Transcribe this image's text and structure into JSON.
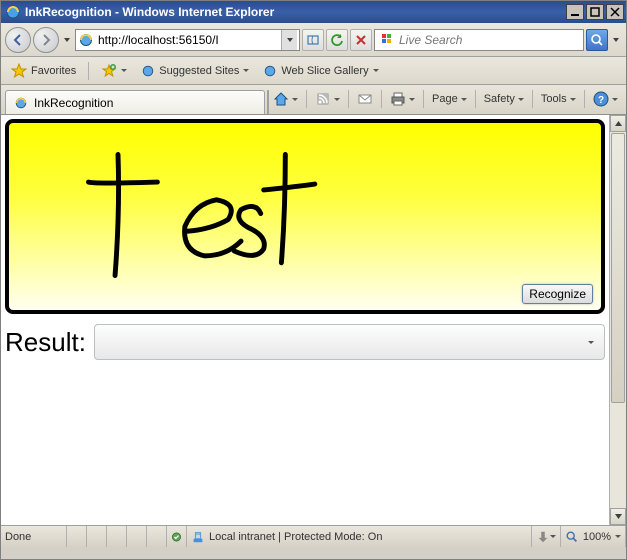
{
  "window": {
    "title": "InkRecognition - Windows Internet Explorer"
  },
  "navigation": {
    "url": "http://localhost:56150/I",
    "search_placeholder": "Live Search"
  },
  "favorites": {
    "button": "Favorites",
    "suggested": "Suggested Sites",
    "webslice": "Web Slice Gallery"
  },
  "tab": {
    "label": "InkRecognition"
  },
  "command_bar": {
    "page": "Page",
    "safety": "Safety",
    "tools": "Tools"
  },
  "page_content": {
    "recognize_button": "Recognize",
    "result_label": "Result:",
    "ink_text": "Test"
  },
  "status": {
    "done": "Done",
    "zone": "Local intranet | Protected Mode: On",
    "zoom": "100%"
  }
}
